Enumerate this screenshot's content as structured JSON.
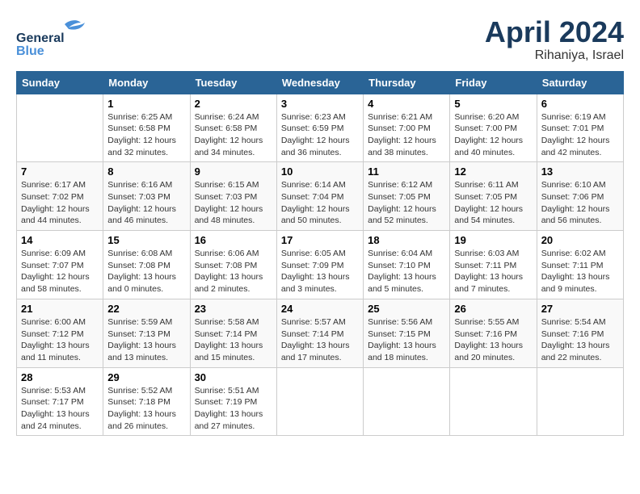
{
  "logo": {
    "text_general": "General",
    "text_blue": "Blue"
  },
  "header": {
    "month": "April 2024",
    "location": "Rihaniya, Israel"
  },
  "weekdays": [
    "Sunday",
    "Monday",
    "Tuesday",
    "Wednesday",
    "Thursday",
    "Friday",
    "Saturday"
  ],
  "weeks": [
    [
      null,
      {
        "day": "1",
        "sunrise": "Sunrise: 6:25 AM",
        "sunset": "Sunset: 6:58 PM",
        "daylight": "Daylight: 12 hours and 32 minutes."
      },
      {
        "day": "2",
        "sunrise": "Sunrise: 6:24 AM",
        "sunset": "Sunset: 6:58 PM",
        "daylight": "Daylight: 12 hours and 34 minutes."
      },
      {
        "day": "3",
        "sunrise": "Sunrise: 6:23 AM",
        "sunset": "Sunset: 6:59 PM",
        "daylight": "Daylight: 12 hours and 36 minutes."
      },
      {
        "day": "4",
        "sunrise": "Sunrise: 6:21 AM",
        "sunset": "Sunset: 7:00 PM",
        "daylight": "Daylight: 12 hours and 38 minutes."
      },
      {
        "day": "5",
        "sunrise": "Sunrise: 6:20 AM",
        "sunset": "Sunset: 7:00 PM",
        "daylight": "Daylight: 12 hours and 40 minutes."
      },
      {
        "day": "6",
        "sunrise": "Sunrise: 6:19 AM",
        "sunset": "Sunset: 7:01 PM",
        "daylight": "Daylight: 12 hours and 42 minutes."
      }
    ],
    [
      {
        "day": "7",
        "sunrise": "Sunrise: 6:17 AM",
        "sunset": "Sunset: 7:02 PM",
        "daylight": "Daylight: 12 hours and 44 minutes."
      },
      {
        "day": "8",
        "sunrise": "Sunrise: 6:16 AM",
        "sunset": "Sunset: 7:03 PM",
        "daylight": "Daylight: 12 hours and 46 minutes."
      },
      {
        "day": "9",
        "sunrise": "Sunrise: 6:15 AM",
        "sunset": "Sunset: 7:03 PM",
        "daylight": "Daylight: 12 hours and 48 minutes."
      },
      {
        "day": "10",
        "sunrise": "Sunrise: 6:14 AM",
        "sunset": "Sunset: 7:04 PM",
        "daylight": "Daylight: 12 hours and 50 minutes."
      },
      {
        "day": "11",
        "sunrise": "Sunrise: 6:12 AM",
        "sunset": "Sunset: 7:05 PM",
        "daylight": "Daylight: 12 hours and 52 minutes."
      },
      {
        "day": "12",
        "sunrise": "Sunrise: 6:11 AM",
        "sunset": "Sunset: 7:05 PM",
        "daylight": "Daylight: 12 hours and 54 minutes."
      },
      {
        "day": "13",
        "sunrise": "Sunrise: 6:10 AM",
        "sunset": "Sunset: 7:06 PM",
        "daylight": "Daylight: 12 hours and 56 minutes."
      }
    ],
    [
      {
        "day": "14",
        "sunrise": "Sunrise: 6:09 AM",
        "sunset": "Sunset: 7:07 PM",
        "daylight": "Daylight: 12 hours and 58 minutes."
      },
      {
        "day": "15",
        "sunrise": "Sunrise: 6:08 AM",
        "sunset": "Sunset: 7:08 PM",
        "daylight": "Daylight: 13 hours and 0 minutes."
      },
      {
        "day": "16",
        "sunrise": "Sunrise: 6:06 AM",
        "sunset": "Sunset: 7:08 PM",
        "daylight": "Daylight: 13 hours and 2 minutes."
      },
      {
        "day": "17",
        "sunrise": "Sunrise: 6:05 AM",
        "sunset": "Sunset: 7:09 PM",
        "daylight": "Daylight: 13 hours and 3 minutes."
      },
      {
        "day": "18",
        "sunrise": "Sunrise: 6:04 AM",
        "sunset": "Sunset: 7:10 PM",
        "daylight": "Daylight: 13 hours and 5 minutes."
      },
      {
        "day": "19",
        "sunrise": "Sunrise: 6:03 AM",
        "sunset": "Sunset: 7:11 PM",
        "daylight": "Daylight: 13 hours and 7 minutes."
      },
      {
        "day": "20",
        "sunrise": "Sunrise: 6:02 AM",
        "sunset": "Sunset: 7:11 PM",
        "daylight": "Daylight: 13 hours and 9 minutes."
      }
    ],
    [
      {
        "day": "21",
        "sunrise": "Sunrise: 6:00 AM",
        "sunset": "Sunset: 7:12 PM",
        "daylight": "Daylight: 13 hours and 11 minutes."
      },
      {
        "day": "22",
        "sunrise": "Sunrise: 5:59 AM",
        "sunset": "Sunset: 7:13 PM",
        "daylight": "Daylight: 13 hours and 13 minutes."
      },
      {
        "day": "23",
        "sunrise": "Sunrise: 5:58 AM",
        "sunset": "Sunset: 7:14 PM",
        "daylight": "Daylight: 13 hours and 15 minutes."
      },
      {
        "day": "24",
        "sunrise": "Sunrise: 5:57 AM",
        "sunset": "Sunset: 7:14 PM",
        "daylight": "Daylight: 13 hours and 17 minutes."
      },
      {
        "day": "25",
        "sunrise": "Sunrise: 5:56 AM",
        "sunset": "Sunset: 7:15 PM",
        "daylight": "Daylight: 13 hours and 18 minutes."
      },
      {
        "day": "26",
        "sunrise": "Sunrise: 5:55 AM",
        "sunset": "Sunset: 7:16 PM",
        "daylight": "Daylight: 13 hours and 20 minutes."
      },
      {
        "day": "27",
        "sunrise": "Sunrise: 5:54 AM",
        "sunset": "Sunset: 7:16 PM",
        "daylight": "Daylight: 13 hours and 22 minutes."
      }
    ],
    [
      {
        "day": "28",
        "sunrise": "Sunrise: 5:53 AM",
        "sunset": "Sunset: 7:17 PM",
        "daylight": "Daylight: 13 hours and 24 minutes."
      },
      {
        "day": "29",
        "sunrise": "Sunrise: 5:52 AM",
        "sunset": "Sunset: 7:18 PM",
        "daylight": "Daylight: 13 hours and 26 minutes."
      },
      {
        "day": "30",
        "sunrise": "Sunrise: 5:51 AM",
        "sunset": "Sunset: 7:19 PM",
        "daylight": "Daylight: 13 hours and 27 minutes."
      },
      null,
      null,
      null,
      null
    ]
  ]
}
